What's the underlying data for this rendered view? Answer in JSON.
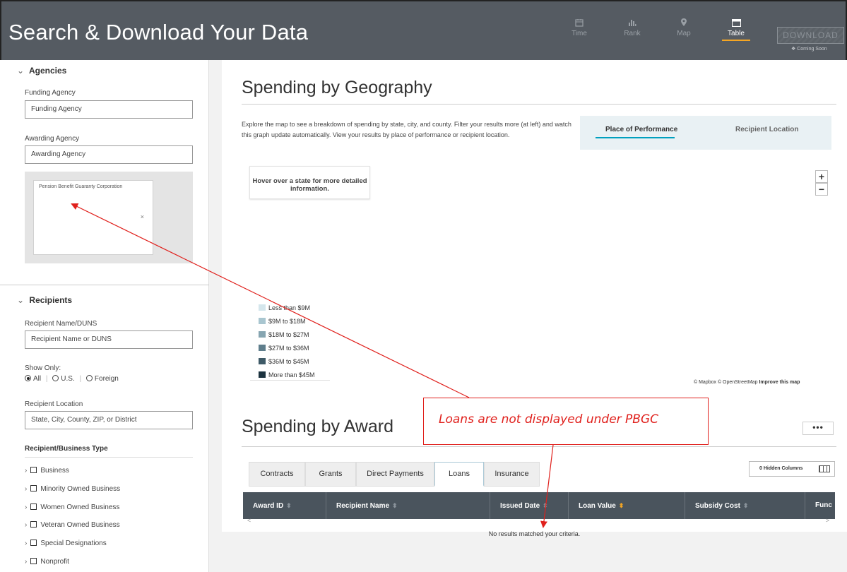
{
  "header": {
    "title": "Search & Download Your Data",
    "views": [
      {
        "label": "Time",
        "icon": "calendar-icon"
      },
      {
        "label": "Rank",
        "icon": "bar-chart-icon"
      },
      {
        "label": "Map",
        "icon": "map-pin-icon"
      },
      {
        "label": "Table",
        "icon": "table-icon"
      }
    ],
    "active_view": "Table",
    "download_label": "DOWNLOAD",
    "coming_soon": "Coming Soon"
  },
  "sidebar": {
    "agencies": {
      "heading": "Agencies",
      "funding_label": "Funding Agency",
      "funding_placeholder": "Funding Agency",
      "awarding_label": "Awarding Agency",
      "awarding_placeholder": "Awarding Agency",
      "selected_agency": "Pension Benefit Guaranty Corporation",
      "remove_glyph": "×"
    },
    "recipients": {
      "heading": "Recipients",
      "name_label": "Recipient Name/DUNS",
      "name_placeholder": "Recipient Name or DUNS",
      "show_only_label": "Show Only:",
      "show_only_options": [
        "All",
        "U.S.",
        "Foreign"
      ],
      "show_only_selected": "All",
      "location_label": "Recipient Location",
      "location_placeholder": "State, City, County, ZIP, or District",
      "business_type_label": "Recipient/Business Type",
      "business_types": [
        "Business",
        "Minority Owned Business",
        "Women Owned Business",
        "Veteran Owned Business",
        "Special Designations",
        "Nonprofit"
      ]
    }
  },
  "geography": {
    "title": "Spending by Geography",
    "description": "Explore the map to see a breakdown of spending by state, city, and county. Filter your results more (at left) and watch this graph update automatically. View your results by place of performance or recipient location.",
    "tabs": [
      "Place of Performance",
      "Recipient Location"
    ],
    "active_tab": "Place of Performance",
    "hover_hint": "Hover over a state for more detailed information.",
    "zoom_in": "+",
    "zoom_out": "−",
    "legend": [
      {
        "label": "Less than $9M",
        "color": "#d4e6ec"
      },
      {
        "label": "$9M to $18M",
        "color": "#a9c6d0"
      },
      {
        "label": "$18M to $27M",
        "color": "#86a5b1"
      },
      {
        "label": "$27M to $36M",
        "color": "#5f7e8c"
      },
      {
        "label": "$36M to $45M",
        "color": "#3e5a67"
      },
      {
        "label": "More than $45M",
        "color": "#1c3340"
      }
    ],
    "attribution": "© Mapbox © OpenStreetMap",
    "improve_link": "Improve this map"
  },
  "award": {
    "title": "Spending by Award",
    "more_label": "•••",
    "tabs": [
      "Contracts",
      "Grants",
      "Direct Payments",
      "Loans",
      "Insurance"
    ],
    "active_tab": "Loans",
    "hidden_columns": "0 Hidden Columns",
    "columns": [
      "Award ID",
      "Recipient Name",
      "Issued Date",
      "Loan Value",
      "Subsidy Cost",
      "Func"
    ],
    "sorted_column": "Loan Value",
    "scroll_left": "<",
    "scroll_right": ">",
    "empty_message": "No results matched your criteria."
  },
  "annotation": {
    "text": "Loans are not displayed under PBGC",
    "color": "#e0201c"
  }
}
